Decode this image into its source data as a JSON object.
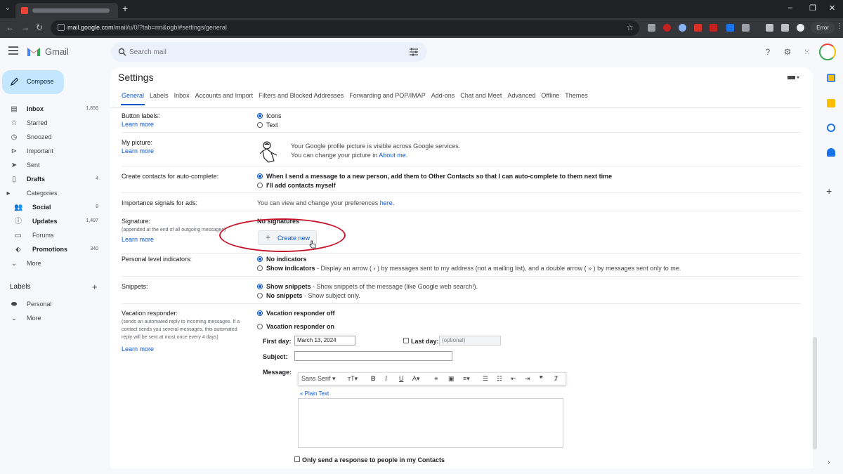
{
  "browser": {
    "url_domain": "mail.google.com",
    "url_path": "/mail/u/0/?tab=rm&ogbl#settings/general",
    "error_label": "Error"
  },
  "app": {
    "name": "Gmail",
    "search_placeholder": "Search mail"
  },
  "sidebar": {
    "compose_label": "Compose",
    "items": [
      {
        "label": "Inbox",
        "count": "1,856",
        "bold": true,
        "icon": "inbox-icon"
      },
      {
        "label": "Starred",
        "count": "",
        "bold": false,
        "icon": "star-icon"
      },
      {
        "label": "Snoozed",
        "count": "",
        "bold": false,
        "icon": "clock-icon"
      },
      {
        "label": "Important",
        "count": "",
        "bold": false,
        "icon": "important-icon"
      },
      {
        "label": "Sent",
        "count": "",
        "bold": false,
        "icon": "send-icon"
      },
      {
        "label": "Drafts",
        "count": "4",
        "bold": true,
        "icon": "draft-icon"
      },
      {
        "label": "Categories",
        "count": "",
        "bold": false,
        "icon": "category-icon"
      },
      {
        "label": "Social",
        "count": "8",
        "bold": true,
        "icon": "people-icon"
      },
      {
        "label": "Updates",
        "count": "1,497",
        "bold": true,
        "icon": "info-icon"
      },
      {
        "label": "Forums",
        "count": "",
        "bold": false,
        "icon": "forum-icon"
      },
      {
        "label": "Promotions",
        "count": "340",
        "bold": true,
        "icon": "tag-icon"
      },
      {
        "label": "More",
        "count": "",
        "bold": false,
        "icon": "chevron-down-icon"
      }
    ],
    "labels_title": "Labels",
    "labels": [
      {
        "label": "Personal",
        "icon": "label-icon"
      },
      {
        "label": "More",
        "icon": "chevron-down-icon"
      }
    ]
  },
  "settings": {
    "title": "Settings",
    "tabs": [
      "General",
      "Labels",
      "Inbox",
      "Accounts and Import",
      "Filters and Blocked Addresses",
      "Forwarding and POP/IMAP",
      "Add-ons",
      "Chat and Meet",
      "Advanced",
      "Offline",
      "Themes"
    ],
    "active_tab": "General",
    "learn_more": "Learn more",
    "button_labels": {
      "label": "Button labels:",
      "options": [
        "Icons",
        "Text"
      ],
      "selected": "Icons"
    },
    "my_picture": {
      "label": "My picture:",
      "line1": "Your Google profile picture is visible across Google services.",
      "line2_prefix": "You can change your picture in ",
      "line2_link": "About me",
      "line2_suffix": "."
    },
    "create_contacts": {
      "label": "Create contacts for auto-complete:",
      "options": [
        "When I send a message to a new person, add them to Other Contacts so that I can auto-complete to them next time",
        "I'll add contacts myself"
      ],
      "selected": 0
    },
    "importance": {
      "label": "Importance signals for ads:",
      "text": "You can view and change your preferences ",
      "link": "here",
      "suffix": "."
    },
    "signature": {
      "label": "Signature:",
      "sub": "(appended at the end of all outgoing messages)",
      "status": "No signatures",
      "create_label": "Create new"
    },
    "personal_level": {
      "label": "Personal level indicators:",
      "option1": "No indicators",
      "option2_bold": "Show indicators",
      "option2_desc": " - Display an arrow ( › ) by messages sent to my address (not a mailing list), and a double arrow ( » ) by messages sent only to me."
    },
    "snippets": {
      "label": "Snippets:",
      "option1_bold": "Show snippets",
      "option1_desc": " - Show snippets of the message (like Google web search!).",
      "option2_bold": "No snippets",
      "option2_desc": " - Show subject only."
    },
    "vacation": {
      "label": "Vacation responder:",
      "sub1": "(sends an automated reply to incoming messages. If a",
      "sub2": "contact sends you several messages, this automated",
      "sub3": "reply will be sent at most once every 4 days)",
      "off": "Vacation responder off",
      "on": "Vacation responder on",
      "first_day_label": "First day:",
      "first_day_value": "March 13, 2024",
      "last_day_label": "Last day:",
      "last_day_placeholder": "(optional)",
      "subject_label": "Subject:",
      "message_label": "Message:",
      "font": "Sans Serif",
      "plain_text": "« Plain Text",
      "only_contacts": "Only send a response to people in my Contacts"
    }
  },
  "colors": {
    "accent": "#0b57d0",
    "compose_bg": "#c2e7ff",
    "annotation_red": "#c5162e"
  }
}
